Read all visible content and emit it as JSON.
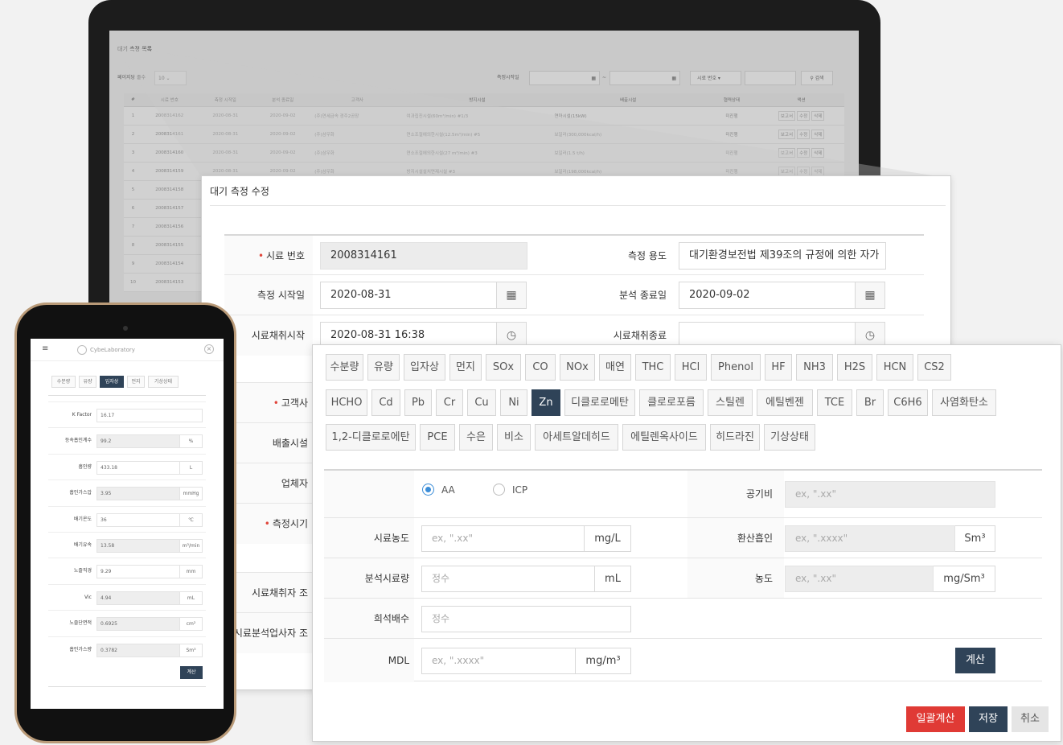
{
  "laptop": {
    "list_title": "대기 측정 목록",
    "page_size_label": "페이지당 줄수",
    "page_size_value": "10",
    "measure_start_label": "측정시작일",
    "range_sep": "~",
    "search_field_select": "시료 번호",
    "search_button": "검색",
    "columns": [
      "#",
      "시료 번호",
      "측정 시작일",
      "분석 종료일",
      "고객사",
      "방지시설",
      "배출시설",
      "협력상태",
      "액션"
    ],
    "rows": [
      {
        "no": "1",
        "sample": "2008314162",
        "start": "2020-08-31",
        "end": "2020-09-02",
        "customer": "(주)연세금속 경주2공장",
        "prevention": "여과집진시설(60m³/min) #1/3",
        "emission": "연마시설(15kW)",
        "status": "미진행"
      },
      {
        "no": "2",
        "sample": "2008314161",
        "start": "2020-08-31",
        "end": "2020-09-02",
        "customer": "(주)삼우화",
        "prevention": "연소조절에의한시설(12.5m³/min) #5",
        "emission": "보일러(300,000kcal/h)",
        "status": "미진행"
      },
      {
        "no": "3",
        "sample": "2008314160",
        "start": "2020-08-31",
        "end": "2020-09-02",
        "customer": "(주)삼우화",
        "prevention": "연소조절에의한시설(27 m³/min) #3",
        "emission": "보일러(1.5 t/h)",
        "status": "미진행"
      },
      {
        "no": "4",
        "sample": "2008314159",
        "start": "2020-08-31",
        "end": "2020-09-02",
        "customer": "(주)삼우화",
        "prevention": "방지시설설치면제시설 #3",
        "emission": "보일러(198,000kcal/h)",
        "status": "미진행"
      },
      {
        "no": "5",
        "sample": "2008314158",
        "start": "",
        "end": "",
        "customer": "",
        "prevention": "",
        "emission": "",
        "status": ""
      },
      {
        "no": "6",
        "sample": "2008314157",
        "start": "",
        "end": "",
        "customer": "",
        "prevention": "",
        "emission": "",
        "status": ""
      },
      {
        "no": "7",
        "sample": "2008314156",
        "start": "",
        "end": "",
        "customer": "",
        "prevention": "",
        "emission": "",
        "status": ""
      },
      {
        "no": "8",
        "sample": "2008314155",
        "start": "",
        "end": "",
        "customer": "",
        "prevention": "",
        "emission": "",
        "status": ""
      },
      {
        "no": "9",
        "sample": "2008314154",
        "start": "",
        "end": "",
        "customer": "",
        "prevention": "",
        "emission": "",
        "status": ""
      },
      {
        "no": "10",
        "sample": "2008314153",
        "start": "",
        "end": "",
        "customer": "",
        "prevention": "",
        "emission": "",
        "status": ""
      }
    ],
    "actions": [
      "보고서",
      "수정",
      "삭제"
    ]
  },
  "edit_dialog": {
    "title": "대기 측정 수정",
    "sample_no_label": "시료 번호",
    "sample_no_value": "2008314161",
    "purpose_label": "측정 용도",
    "purpose_value": "대기환경보전법 제39조의 규정에 의한 자가",
    "start_date_label": "측정 시작일",
    "start_date_value": "2020-08-31",
    "end_date_label": "분석 종료일",
    "end_date_value": "2020-09-02",
    "sampling_start_label": "시료채취시작",
    "sampling_start_value": "2020-08-31 16:38",
    "sampling_end_label": "시료채취종료",
    "sampling_end_value": "",
    "customer_label": "고객사",
    "emission_label": "배출시설",
    "business_label": "업체자",
    "measure_time_label": "측정시기",
    "sampler_label": "시료채취자 조",
    "analyst_label": "시료분석업사자 조"
  },
  "calc_panel": {
    "items": [
      "수분량",
      "유량",
      "입자상",
      "먼지",
      "SOx",
      "CO",
      "NOx",
      "매연",
      "THC",
      "HCl",
      "Phenol",
      "HF",
      "NH3",
      "H2S",
      "HCN",
      "CS2",
      "HCHO",
      "Cd",
      "Pb",
      "Cr",
      "Cu",
      "Ni",
      "Zn",
      "디클로로메탄",
      "클로로포름",
      "스틸렌",
      "에틸벤젠",
      "TCE",
      "Br",
      "C6H6",
      "사염화탄소",
      "1,2-디클로로에탄",
      "PCE",
      "수은",
      "비소",
      "아세트알데히드",
      "에틸렌옥사이드",
      "히드라진",
      "기상상태"
    ],
    "active_item": "Zn",
    "radio_aa": "AA",
    "radio_icp": "ICP",
    "blank_label": "공기비",
    "blank_placeholder": "ex, \".xx\"",
    "sample_conc_label": "시료농도",
    "sample_conc_placeholder": "ex, \".xx\"",
    "sample_conc_unit": "mg/L",
    "converted_label": "환산흡인",
    "converted_placeholder": "ex, \".xxxx\"",
    "converted_unit": "Sm³",
    "analysis_amount_label": "분석시료량",
    "analysis_amount_placeholder": "정수",
    "analysis_amount_unit": "mL",
    "concentration_label": "농도",
    "concentration_placeholder": "ex, \".xx\"",
    "concentration_unit": "mg/Sm³",
    "dilution_label": "희석배수",
    "dilution_placeholder": "정수",
    "mdl_label": "MDL",
    "mdl_placeholder": "ex, \".xxxx\"",
    "mdl_unit": "mg/m³",
    "calc_button": "계산",
    "batch_button": "일괄계산",
    "save_button": "저장",
    "cancel_button": "취소",
    "colors": {
      "active": "#2f4358",
      "danger": "#e03a35",
      "primary": "#2f4358",
      "radio": "#3b8dd8"
    }
  },
  "phone": {
    "brand": "CybeLaboratory",
    "tabs": [
      "수분량",
      "유량",
      "입자상",
      "먼지",
      "기상상태"
    ],
    "active_tab": "입자상",
    "rows": [
      {
        "label": "K Factor",
        "value": "16.17",
        "unit": "",
        "ro": false
      },
      {
        "label": "등속흡인계수",
        "value": "99.2",
        "unit": "%",
        "ro": true
      },
      {
        "label": "흡인량",
        "value": "433.18",
        "unit": "L",
        "ro": false
      },
      {
        "label": "흡인가스압",
        "value": "3.95",
        "unit": "mmHg",
        "ro": true
      },
      {
        "label": "배기온도",
        "value": "36",
        "unit": "℃",
        "ro": false
      },
      {
        "label": "배기유속",
        "value": "13.58",
        "unit": "m³/min",
        "ro": true
      },
      {
        "label": "노즐직경",
        "value": "9.29",
        "unit": "mm",
        "ro": false
      },
      {
        "label": "Vic",
        "value": "4.94",
        "unit": "mL",
        "ro": true
      },
      {
        "label": "노즐단면적",
        "value": "0.6925",
        "unit": "cm²",
        "ro": true
      },
      {
        "label": "흡인가스량",
        "value": "0.3782",
        "unit": "Sm³",
        "ro": true
      }
    ],
    "calc_button": "계산"
  }
}
